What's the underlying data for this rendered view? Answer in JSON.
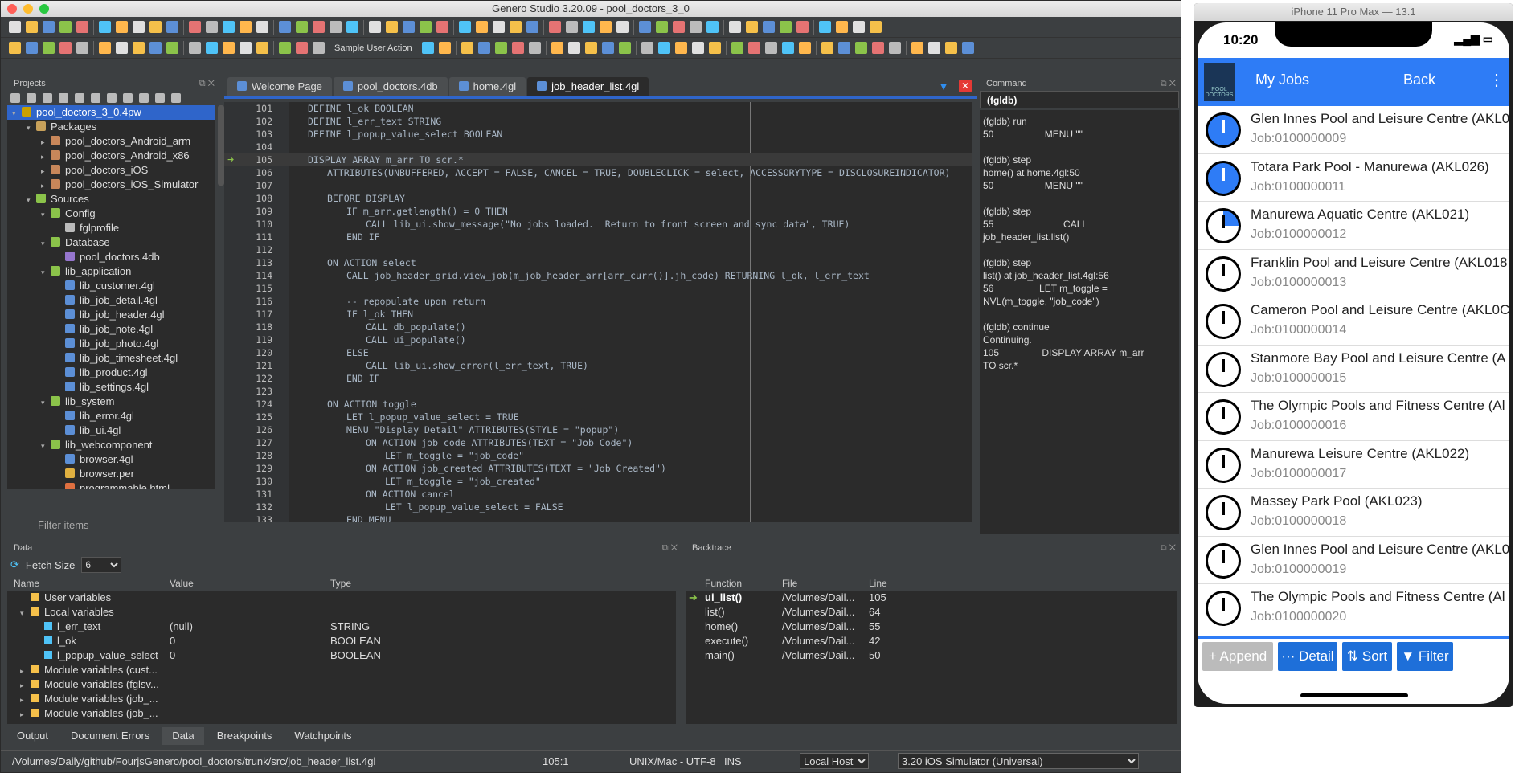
{
  "ide": {
    "title": "Genero Studio 3.20.09 - pool_doctors_3_0",
    "toolbar_action_label": "Sample User Action",
    "projects": {
      "header": "Projects",
      "filter_placeholder": "Filter items",
      "items": [
        {
          "label": "pool_doctors_3_0.4pw",
          "level": 0,
          "arrow": "▾",
          "color": "#c9a000",
          "selected": true
        },
        {
          "label": "Packages",
          "level": 1,
          "arrow": "▾",
          "color": "#c8a15a"
        },
        {
          "label": "pool_doctors_Android_arm",
          "level": 2,
          "arrow": "▸",
          "color": "#c8875a"
        },
        {
          "label": "pool_doctors_Android_x86",
          "level": 2,
          "arrow": "▸",
          "color": "#c8875a"
        },
        {
          "label": "pool_doctors_iOS",
          "level": 2,
          "arrow": "▸",
          "color": "#c8875a"
        },
        {
          "label": "pool_doctors_iOS_Simulator",
          "level": 2,
          "arrow": "▸",
          "color": "#c8875a"
        },
        {
          "label": "Sources",
          "level": 1,
          "arrow": "▾",
          "color": "#8bc34a"
        },
        {
          "label": "Config",
          "level": 2,
          "arrow": "▾",
          "color": "#8bc34a"
        },
        {
          "label": "fglprofile",
          "level": 3,
          "arrow": "",
          "color": "#bbb"
        },
        {
          "label": "Database",
          "level": 2,
          "arrow": "▾",
          "color": "#8bc34a"
        },
        {
          "label": "pool_doctors.4db",
          "level": 3,
          "arrow": "",
          "color": "#9575cd"
        },
        {
          "label": "lib_application",
          "level": 2,
          "arrow": "▾",
          "color": "#8bc34a"
        },
        {
          "label": "lib_customer.4gl",
          "level": 3,
          "arrow": "",
          "color": "#5c8fd6"
        },
        {
          "label": "lib_job_detail.4gl",
          "level": 3,
          "arrow": "",
          "color": "#5c8fd6"
        },
        {
          "label": "lib_job_header.4gl",
          "level": 3,
          "arrow": "",
          "color": "#5c8fd6"
        },
        {
          "label": "lib_job_note.4gl",
          "level": 3,
          "arrow": "",
          "color": "#5c8fd6"
        },
        {
          "label": "lib_job_photo.4gl",
          "level": 3,
          "arrow": "",
          "color": "#5c8fd6"
        },
        {
          "label": "lib_job_timesheet.4gl",
          "level": 3,
          "arrow": "",
          "color": "#5c8fd6"
        },
        {
          "label": "lib_product.4gl",
          "level": 3,
          "arrow": "",
          "color": "#5c8fd6"
        },
        {
          "label": "lib_settings.4gl",
          "level": 3,
          "arrow": "",
          "color": "#5c8fd6"
        },
        {
          "label": "lib_system",
          "level": 2,
          "arrow": "▾",
          "color": "#8bc34a"
        },
        {
          "label": "lib_error.4gl",
          "level": 3,
          "arrow": "",
          "color": "#5c8fd6"
        },
        {
          "label": "lib_ui.4gl",
          "level": 3,
          "arrow": "",
          "color": "#5c8fd6"
        },
        {
          "label": "lib_webcomponent",
          "level": 2,
          "arrow": "▾",
          "color": "#8bc34a"
        },
        {
          "label": "browser.4gl",
          "level": 3,
          "arrow": "",
          "color": "#5c8fd6"
        },
        {
          "label": "browser.per",
          "level": 3,
          "arrow": "",
          "color": "#e0b040"
        },
        {
          "label": "programmable.html",
          "level": 3,
          "arrow": "",
          "color": "#e07040"
        }
      ]
    },
    "editor": {
      "tabs": [
        {
          "label": "Welcome Page",
          "active": false
        },
        {
          "label": "pool_doctors.4db",
          "active": false
        },
        {
          "label": "home.4gl",
          "active": false
        },
        {
          "label": "job_header_list.4gl",
          "active": true
        }
      ],
      "lines": [
        {
          "n": "101",
          "html": "DEFINE l_ok BOOLEAN",
          "indent": 0
        },
        {
          "n": "102",
          "html": "DEFINE l_err_text STRING",
          "indent": 0
        },
        {
          "n": "103",
          "html": "DEFINE l_popup_value_select BOOLEAN",
          "indent": 0
        },
        {
          "n": "104",
          "html": "",
          "indent": 0
        },
        {
          "n": "105",
          "html": "DISPLAY ARRAY m_arr TO scr.*",
          "indent": 0,
          "current": true
        },
        {
          "n": "106",
          "html": "ATTRIBUTES(UNBUFFERED, ACCEPT = FALSE, CANCEL = TRUE, DOUBLECLICK = select, ACCESSORYTYPE = DISCLOSUREINDICATOR)",
          "indent": 1
        },
        {
          "n": "107",
          "html": "",
          "indent": 0
        },
        {
          "n": "108",
          "html": "BEFORE DISPLAY",
          "indent": 1
        },
        {
          "n": "109",
          "html": "IF m_arr.getlength() = 0 THEN",
          "indent": 2
        },
        {
          "n": "110",
          "html": "CALL lib_ui.show_message(\"No jobs loaded.  Return to front screen and sync data\", TRUE)",
          "indent": 3
        },
        {
          "n": "111",
          "html": "END IF",
          "indent": 2
        },
        {
          "n": "112",
          "html": "",
          "indent": 0
        },
        {
          "n": "113",
          "html": "ON ACTION select",
          "indent": 1
        },
        {
          "n": "114",
          "html": "CALL job_header_grid.view_job(m_job_header_arr[arr_curr()].jh_code) RETURNING l_ok, l_err_text",
          "indent": 2
        },
        {
          "n": "115",
          "html": "",
          "indent": 0
        },
        {
          "n": "116",
          "html": "-- repopulate upon return",
          "indent": 2,
          "comment": true
        },
        {
          "n": "117",
          "html": "IF l_ok THEN",
          "indent": 2
        },
        {
          "n": "118",
          "html": "CALL db_populate()",
          "indent": 3
        },
        {
          "n": "119",
          "html": "CALL ui_populate()",
          "indent": 3
        },
        {
          "n": "120",
          "html": "ELSE",
          "indent": 2
        },
        {
          "n": "121",
          "html": "CALL lib_ui.show_error(l_err_text, TRUE)",
          "indent": 3
        },
        {
          "n": "122",
          "html": "END IF",
          "indent": 2
        },
        {
          "n": "123",
          "html": "",
          "indent": 0
        },
        {
          "n": "124",
          "html": "ON ACTION toggle",
          "indent": 1
        },
        {
          "n": "125",
          "html": "LET l_popup_value_select = TRUE",
          "indent": 2
        },
        {
          "n": "126",
          "html": "MENU \"Display Detail\" ATTRIBUTES(STYLE = \"popup\")",
          "indent": 2
        },
        {
          "n": "127",
          "html": "ON ACTION job_code ATTRIBUTES(TEXT = \"Job Code\")",
          "indent": 3
        },
        {
          "n": "128",
          "html": "LET m_toggle = \"job_code\"",
          "indent": 4
        },
        {
          "n": "129",
          "html": "ON ACTION job_created ATTRIBUTES(TEXT = \"Job Created\")",
          "indent": 3
        },
        {
          "n": "130",
          "html": "LET m_toggle = \"job_created\"",
          "indent": 4
        },
        {
          "n": "131",
          "html": "ON ACTION cancel",
          "indent": 3
        },
        {
          "n": "132",
          "html": "LET l_popup_value_select = FALSE",
          "indent": 4
        },
        {
          "n": "133",
          "html": "END MENU",
          "indent": 2
        }
      ]
    },
    "command": {
      "header": "Command",
      "prompt": "(fgldb)",
      "output": "(fgldb) run\n50                   MENU \"\"\n\n(fgldb) step\nhome() at home.4gl:50\n50                   MENU \"\"\n\n(fgldb) step\n55                          CALL\njob_header_list.list()\n\n(fgldb) step\nlist() at job_header_list.4gl:56\n56                 LET m_toggle =\nNVL(m_toggle, \"job_code\")\n\n(fgldb) continue\nContinuing.\n105                DISPLAY ARRAY m_arr\nTO scr.*"
    },
    "data": {
      "header": "Data",
      "fetch_size_label": "Fetch Size",
      "fetch_size_value": "6",
      "columns": [
        "Name",
        "Value",
        "Type"
      ],
      "rows": [
        {
          "name": "User variables",
          "value": "",
          "type": "",
          "level": 1,
          "arrow": ""
        },
        {
          "name": "Local variables",
          "value": "",
          "type": "",
          "level": 1,
          "arrow": "▾"
        },
        {
          "name": "l_err_text",
          "value": "(null)",
          "type": "STRING",
          "level": 2,
          "arrow": ""
        },
        {
          "name": "l_ok",
          "value": "0",
          "type": "BOOLEAN",
          "level": 2,
          "arrow": ""
        },
        {
          "name": "l_popup_value_select",
          "value": "0",
          "type": "BOOLEAN",
          "level": 2,
          "arrow": ""
        },
        {
          "name": "Module variables (cust...",
          "value": "",
          "type": "",
          "level": 1,
          "arrow": "▸"
        },
        {
          "name": "Module variables (fglsv...",
          "value": "",
          "type": "",
          "level": 1,
          "arrow": "▸"
        },
        {
          "name": "Module variables (job_...",
          "value": "",
          "type": "",
          "level": 1,
          "arrow": "▸"
        },
        {
          "name": "Module variables (job_...",
          "value": "",
          "type": "",
          "level": 1,
          "arrow": "▸"
        }
      ]
    },
    "backtrace": {
      "header": "Backtrace",
      "columns": [
        "Function",
        "File",
        "Line"
      ],
      "rows": [
        {
          "fn": "ui_list()",
          "file": "/Volumes/Dail...",
          "line": "105",
          "current": true
        },
        {
          "fn": "list()",
          "file": "/Volumes/Dail...",
          "line": "64"
        },
        {
          "fn": "home()",
          "file": "/Volumes/Dail...",
          "line": "55"
        },
        {
          "fn": "execute()",
          "file": "/Volumes/Dail...",
          "line": "42"
        },
        {
          "fn": "main()",
          "file": "/Volumes/Dail...",
          "line": "50"
        }
      ]
    },
    "bottom_tabs": [
      "Output",
      "Document Errors",
      "Data",
      "Breakpoints",
      "Watchpoints"
    ],
    "bottom_tab_active": "Data",
    "status": {
      "path": "/Volumes/Daily/github/FourjsGenero/pool_doctors/trunk/src/job_header_list.4gl",
      "position": "105:1",
      "encoding": "UNIX/Mac - UTF-8",
      "mode": "INS",
      "host": "Local Host",
      "target": "3.20 iOS Simulator (Universal)"
    }
  },
  "phone": {
    "window_title": "iPhone 11 Pro Max — 13.1",
    "time": "10:20",
    "app_title": "My Jobs",
    "back_label": "Back",
    "logo_text": "POOL DOCTORS",
    "jobs": [
      {
        "title": "Glen Innes Pool and Leisure Centre (AKL0",
        "job": "Job:0100000009",
        "style": "blue"
      },
      {
        "title": "Totara Park Pool - Manurewa (AKL026)",
        "job": "Job:0100000011",
        "style": "blue"
      },
      {
        "title": "Manurewa Aquatic Centre (AKL021)",
        "job": "Job:0100000012",
        "style": "quarter"
      },
      {
        "title": "Franklin Pool and Leisure Centre (AKL018",
        "job": "Job:0100000013",
        "style": "plain"
      },
      {
        "title": "Cameron Pool and Leisure Centre (AKL0C",
        "job": "Job:0100000014",
        "style": "plain"
      },
      {
        "title": "Stanmore Bay Pool and Leisure Centre (A",
        "job": "Job:0100000015",
        "style": "plain"
      },
      {
        "title": "The Olympic Pools and Fitness Centre (Al",
        "job": "Job:0100000016",
        "style": "plain"
      },
      {
        "title": "Manurewa Leisure Centre (AKL022)",
        "job": "Job:0100000017",
        "style": "plain"
      },
      {
        "title": "Massey Park Pool (AKL023)",
        "job": "Job:0100000018",
        "style": "plain"
      },
      {
        "title": "Glen Innes Pool and Leisure Centre (AKL0",
        "job": "Job:0100000019",
        "style": "plain"
      },
      {
        "title": "The Olympic Pools and Fitness Centre (Al",
        "job": "Job:0100000020",
        "style": "plain"
      }
    ],
    "buttons": [
      {
        "label": "+ Append",
        "disabled": true
      },
      {
        "label": "··· Detail",
        "disabled": false
      },
      {
        "label": "⇅ Sort",
        "disabled": false
      },
      {
        "label": "▼ Filter",
        "disabled": false
      }
    ]
  }
}
